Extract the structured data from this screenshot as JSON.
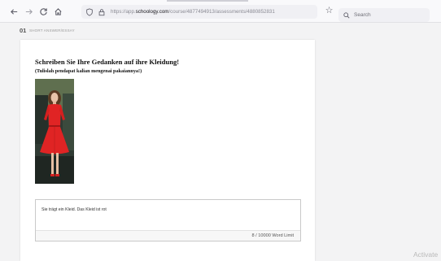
{
  "browser": {
    "url_prefix": "https://app.",
    "url_domain": "schoology.com",
    "url_path": "/course/4877494913/assessments/4880852831",
    "search_placeholder": "Search"
  },
  "question": {
    "number": "01",
    "type": "SHORT ANSWER/ESSAY",
    "title": "Schreiben Sie Ihre Gedanken auf ihre Kleidung!",
    "subtitle": "(Tulislah pendapat kalian mengenai pakaiannya!)"
  },
  "answer": {
    "text": "Sie trägt ein Kleid. Das Kleid ist rot",
    "word_count": "8 / 10000 Word Limit"
  },
  "overlay": {
    "activate_text": "Activate"
  },
  "colors": {
    "dress": "#e02424",
    "background_photo": "#2f3a33"
  },
  "icons": [
    "back-arrow-icon",
    "forward-arrow-icon",
    "reload-icon",
    "home-icon",
    "shield-icon",
    "lock-icon",
    "star-icon",
    "search-icon"
  ]
}
